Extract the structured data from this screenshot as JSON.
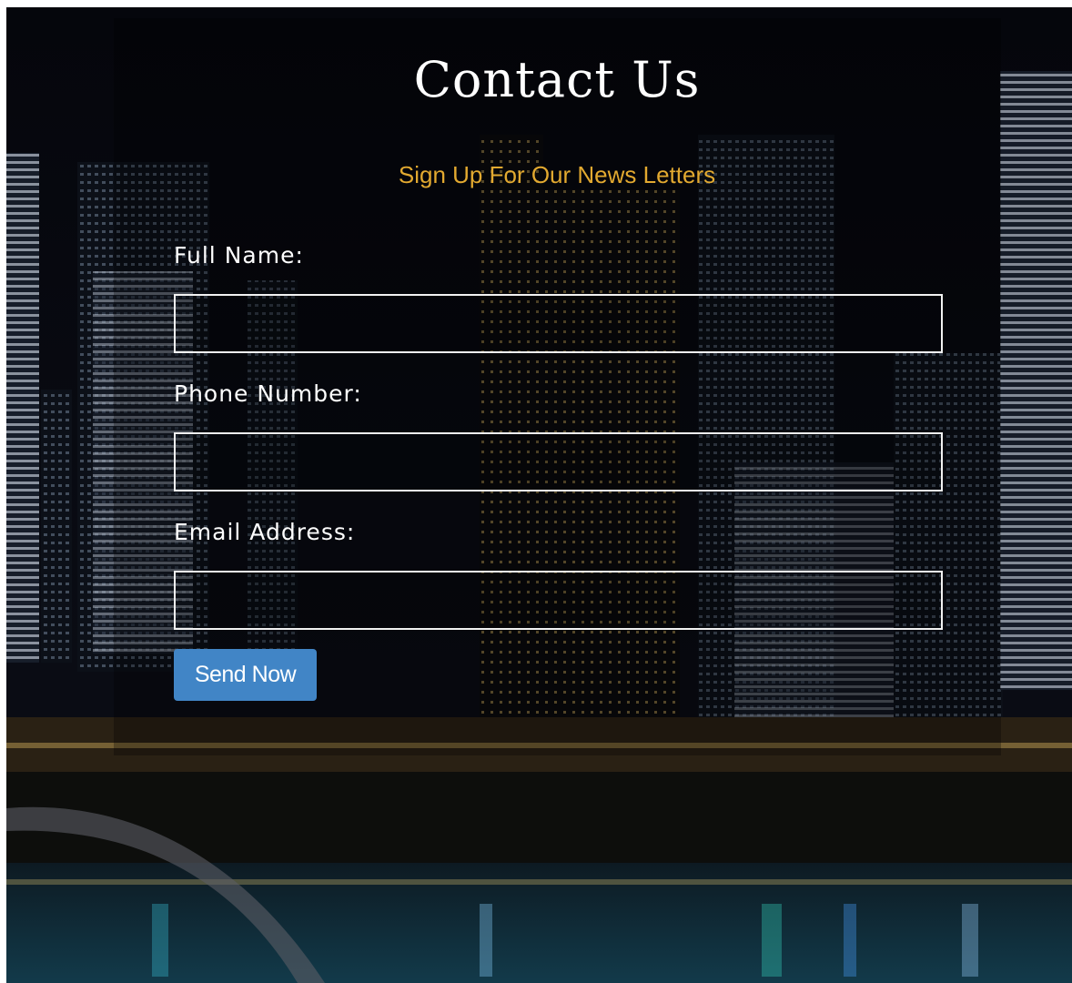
{
  "page": {
    "title": "Contact Us",
    "subtitle": "Sign Up For Our News Letters"
  },
  "form": {
    "full_name": {
      "label": "Full Name:",
      "value": "",
      "placeholder": ""
    },
    "phone": {
      "label": "Phone Number:",
      "value": "",
      "placeholder": ""
    },
    "email": {
      "label": "Email Address:",
      "value": "",
      "placeholder": ""
    },
    "submit_label": "Send Now"
  },
  "colors": {
    "subtitle": "#e2a930",
    "button": "#4185c6",
    "background": "#04050a"
  }
}
